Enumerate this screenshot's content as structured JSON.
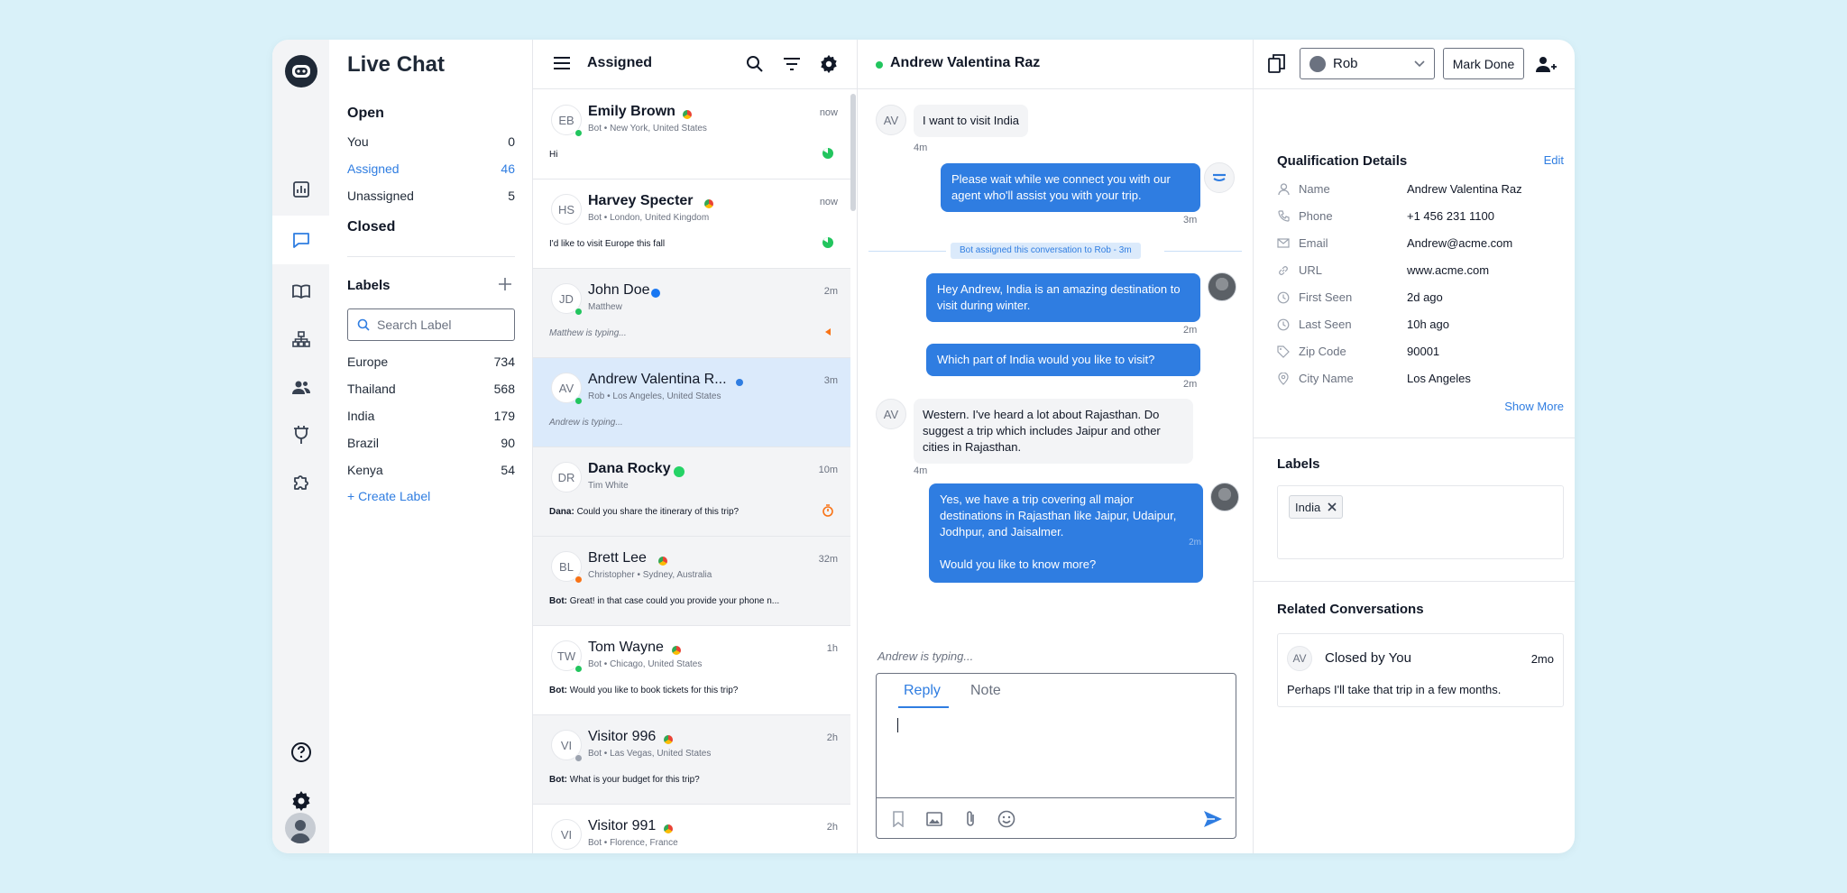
{
  "app": {
    "title": "Live Chat"
  },
  "colors": {
    "accent": "#2f7de1",
    "online": "#22c55e",
    "away": "#9ca3af",
    "background": "#d9f1f9"
  },
  "inbox": {
    "open_title": "Open",
    "items": [
      {
        "label": "You",
        "count": "0"
      },
      {
        "label": "Assigned",
        "count": "46"
      },
      {
        "label": "Unassigned",
        "count": "5"
      }
    ],
    "closed_title": "Closed",
    "labels_title": "Labels",
    "search_placeholder": "Search Label",
    "labels": [
      {
        "label": "Europe",
        "count": "734"
      },
      {
        "label": "Thailand",
        "count": "568"
      },
      {
        "label": "India",
        "count": "179"
      },
      {
        "label": "Brazil",
        "count": "90"
      },
      {
        "label": "Kenya",
        "count": "54"
      }
    ],
    "create_label": "+ Create Label"
  },
  "list": {
    "title": "Assigned",
    "conversations": [
      {
        "initials": "EB",
        "name": "Emily Brown",
        "meta": "Bot • New York, United States",
        "time": "now",
        "preview": "Hi",
        "presence": "online",
        "channel": "chrome"
      },
      {
        "initials": "HS",
        "name": "Harvey Specter",
        "meta": "Bot • London, United Kingdom",
        "time": "now",
        "preview": "I'd like to visit Europe this fall",
        "presence": "online",
        "channel": "chrome"
      },
      {
        "initials": "JD",
        "name": "John Doe",
        "meta": "Matthew",
        "time": "2m",
        "preview": "Matthew is typing...",
        "presence": "online",
        "channel": "facebook"
      },
      {
        "initials": "AV",
        "name": "Andrew Valentina R...",
        "meta": "Rob • Los Angeles, United States",
        "time": "3m",
        "preview": "Andrew is typing...",
        "presence": "online",
        "channel": "web"
      },
      {
        "initials": "DR",
        "name": "Dana Rocky",
        "meta": "Tim White",
        "time": "10m",
        "preview_sender": "Dana:",
        "preview": " Could you share the itinerary of this trip?",
        "presence": "none",
        "channel": "whatsapp"
      },
      {
        "initials": "BL",
        "name": "Brett Lee",
        "meta": "Christopher • Sydney, Australia",
        "time": "32m",
        "preview_sender": "Bot:",
        "preview": " Great! in that case could you provide your phone n...",
        "presence": "orange",
        "channel": "chrome"
      },
      {
        "initials": "TW",
        "name": "Tom Wayne",
        "meta": "Bot • Chicago, United States",
        "time": "1h",
        "preview_sender": "Bot:",
        "preview": " Would you like to book tickets for this trip?",
        "presence": "online",
        "channel": "chrome"
      },
      {
        "initials": "VI",
        "name": "Visitor 996",
        "meta": "Bot • Las Vegas, United States",
        "time": "2h",
        "preview_sender": "Bot:",
        "preview": " What is your budget for this trip?",
        "presence": "away",
        "channel": "chrome"
      },
      {
        "initials": "VI",
        "name": "Visitor 991",
        "meta": "Bot • Florence, France",
        "time": "2h",
        "preview": "",
        "presence": "online",
        "channel": "chrome"
      }
    ]
  },
  "chat": {
    "contact_name": "Andrew Valentina Raz",
    "assignee": "Rob",
    "mark_done": "Mark Done",
    "messages": [
      {
        "from": "AV",
        "text": "I want to visit India",
        "time": "4m"
      },
      {
        "from": "bot",
        "text": "Please wait while we connect you with our agent who'll assist you with your trip.",
        "time": "3m"
      },
      {
        "system": "Bot assigned this conversation to Rob - 3m"
      },
      {
        "from": "agent",
        "text": "Hey Andrew, India is an amazing destination to visit during winter.",
        "time": "2m"
      },
      {
        "from": "agent",
        "text": "Which part of India would you like to visit?",
        "time": "2m"
      },
      {
        "from": "AV",
        "text": "Western. I've heard a lot about Rajasthan. Do suggest a trip which includes Jaipur and other cities in Rajasthan.",
        "time": "4m"
      },
      {
        "from": "agent",
        "text": "Yes, we have a trip covering all major destinations in Rajasthan like Jaipur, Udaipur, Jodhpur, and Jaisalmer.",
        "text2": "Would you like to know more?",
        "time": "2m"
      }
    ],
    "typing": "Andrew is typing...",
    "composer": {
      "tab_reply": "Reply",
      "tab_note": "Note"
    }
  },
  "details": {
    "title": "Qualification Details",
    "edit": "Edit",
    "fields": [
      {
        "key": "Name",
        "value": "Andrew Valentina Raz",
        "icon": "person-icon"
      },
      {
        "key": "Phone",
        "value": "+1 456 231 1100",
        "icon": "phone-icon"
      },
      {
        "key": "Email",
        "value": "Andrew@acme.com",
        "icon": "mail-icon"
      },
      {
        "key": "URL",
        "value": "www.acme.com",
        "icon": "link-icon"
      },
      {
        "key": "First Seen",
        "value": "2d ago",
        "icon": "clock-icon"
      },
      {
        "key": "Last Seen",
        "value": "10h ago",
        "icon": "clock-icon"
      },
      {
        "key": "Zip Code",
        "value": "90001",
        "icon": "tag-icon"
      },
      {
        "key": "City Name",
        "value": "Los Angeles",
        "icon": "location-icon"
      }
    ],
    "show_more": "Show More",
    "labels_title": "Labels",
    "labels": [
      "India"
    ],
    "related_title": "Related Conversations",
    "related": {
      "initials": "AV",
      "title": "Closed by You",
      "time": "2mo",
      "text": "Perhaps I'll take that trip in a few months."
    }
  }
}
